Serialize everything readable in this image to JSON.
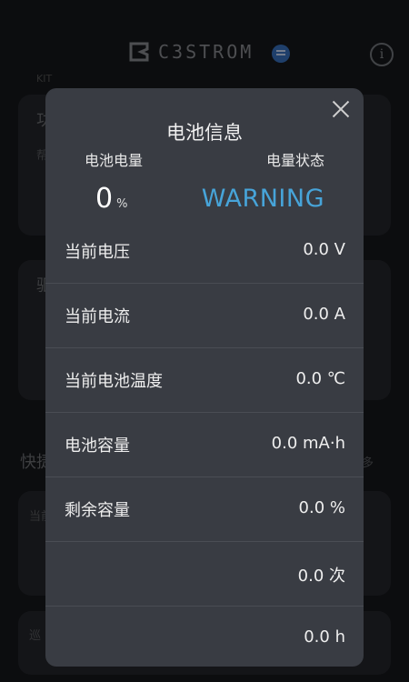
{
  "app": {
    "brand_text": "C3STROM",
    "sub_text": "KIT",
    "bg_labels": [
      "功",
      "帮",
      "驱",
      "快捷",
      "当前",
      "巡",
      "多"
    ]
  },
  "modal": {
    "title": "电池信息",
    "battery_level_label": "电池电量",
    "battery_status_label": "电量状态",
    "battery_level_value": "0",
    "battery_level_unit": "%",
    "battery_status_value": "WARNING",
    "rows": [
      {
        "label": "当前电压",
        "value": "0.0 V"
      },
      {
        "label": "当前电流",
        "value": "0.0 A"
      },
      {
        "label": "当前电池温度",
        "value": "0.0 ℃"
      },
      {
        "label": "电池容量",
        "value": "0.0 mA·h"
      },
      {
        "label": "剩余容量",
        "value": "0.0 %"
      },
      {
        "label": "",
        "value": "0.0 次"
      },
      {
        "label": "",
        "value": "0.0 h"
      }
    ]
  },
  "colors": {
    "status_accent": "#47a4d9",
    "modal_bg": "#393c43",
    "page_bg": "#17191d"
  },
  "icons": {
    "brand": "brand-logo-icon",
    "menu": "menu-icon",
    "info": "info-icon",
    "close": "close-icon"
  }
}
